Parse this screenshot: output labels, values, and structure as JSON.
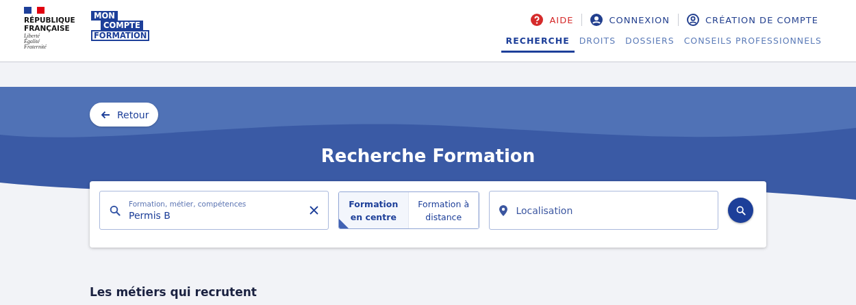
{
  "header": {
    "republic": {
      "name": "RÉPUBLIQUE FRANÇAISE",
      "motto": [
        "Liberté",
        "Égalité",
        "Fraternité"
      ]
    },
    "logo": [
      "MON",
      "COMPTE",
      "FORMATION"
    ],
    "top_links": [
      {
        "label": "AIDE",
        "kind": "help"
      },
      {
        "label": "CONNEXION",
        "kind": "user"
      },
      {
        "label": "CRÉATION DE COMPTE",
        "kind": "account"
      }
    ],
    "nav": [
      {
        "label": "RECHERCHE",
        "selected": true
      },
      {
        "label": "DROITS",
        "selected": false
      },
      {
        "label": "DOSSIERS",
        "selected": false
      },
      {
        "label": "CONSEILS PROFESSIONNELS",
        "selected": false
      }
    ]
  },
  "back_button": "Retour",
  "title": "Recherche Formation",
  "search": {
    "label": "Formation, métier, compétences",
    "value": "Permis B",
    "modes": [
      {
        "label": "Formation en centre",
        "selected": true
      },
      {
        "label": "Formation à distance",
        "selected": false
      }
    ],
    "location_placeholder": "Localisation"
  },
  "section_title": "Les métiers qui recrutent"
}
